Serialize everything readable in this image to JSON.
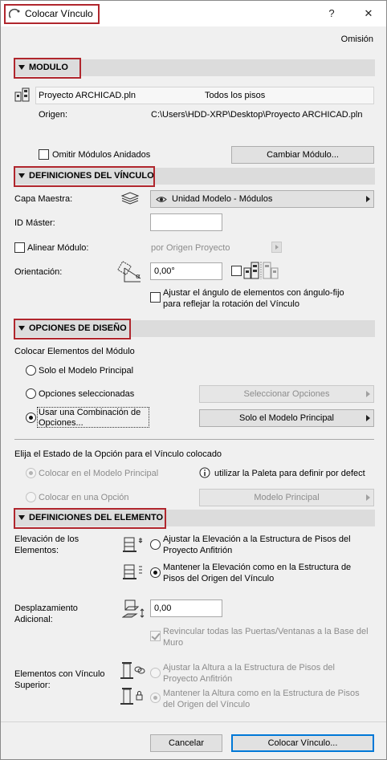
{
  "window": {
    "title": "Colocar Vínculo",
    "help": "?",
    "close": "✕",
    "defaults_label": "Omisión"
  },
  "modulo": {
    "header": "MODULO",
    "project_name": "Proyecto ARCHICAD.pln",
    "stories": "Todos los pisos",
    "origin_label": "Origen:",
    "origin_path": "C:\\Users\\HDD-XRP\\Desktop\\Proyecto ARCHICAD.pln",
    "skip_nested_label": "Omitir Módulos Anidados",
    "change_button": "Cambiar Módulo..."
  },
  "link_settings": {
    "header": "DEFINICIONES DEL VÍNCULO",
    "master_layer_label": "Capa Maestra:",
    "master_layer_value": "Unidad Modelo - Módulos",
    "master_id_label": "ID Máster:",
    "master_id_value": "",
    "align_label": "Alinear Módulo:",
    "align_value": "por Origen Proyecto",
    "orientation_label": "Orientación:",
    "orientation_value": "0,00°",
    "fixed_angle_label_1": "Ajustar el ángulo de elementos con ángulo-fijo",
    "fixed_angle_label_2": "para reflejar la rotación del Vínculo"
  },
  "design_options": {
    "header": "OPCIONES DE DISEÑO",
    "place_elements_label": "Colocar Elementos del Módulo",
    "radio_main_only": "Solo el Modelo Principal",
    "radio_selected": "Opciones seleccionadas",
    "radio_combination_1": "Usar una Combinación de",
    "radio_combination_2": "Opciones...",
    "select_options_button": "Seleccionar Opciones",
    "combination_value": "Solo el Modelo Principal",
    "choose_state_label": "Elija el Estado de la Opción para el Vínculo colocado",
    "place_main_model": "Colocar en el Modelo Principal",
    "info_text": "utilizar la Paleta para definir por defect",
    "place_in_option": "Colocar en una Opción",
    "option_value": "Modelo Principal"
  },
  "element_settings": {
    "header": "DEFINICIONES DEL ELEMENTO",
    "elevation_label_1": "Elevación de los",
    "elevation_label_2": "Elementos:",
    "elev_adjust_1": "Ajustar la Elevación a la Estructura de Pisos del",
    "elev_adjust_2": "Proyecto Anfitrión",
    "elev_keep_1": "Mantener la Elevación como en la Estructura de",
    "elev_keep_2": "Pisos del Origen del Vínculo",
    "offset_label_1": "Desplazamiento",
    "offset_label_2": "Adicional:",
    "offset_value": "0,00",
    "relink_1": "Revincular todas las Puertas/Ventanas a la Base del",
    "relink_2": "Muro",
    "top_linked_label_1": "Elementos con Vínculo",
    "top_linked_label_2": "Superior:",
    "height_adjust_1": "Ajustar la Altura a la Estructura de Pisos del",
    "height_adjust_2": "Proyecto Anfitrión",
    "height_keep_1": "Mantener la Altura como en la Estructura de Pisos",
    "height_keep_2": "del Origen del Vínculo"
  },
  "footer": {
    "cancel": "Cancelar",
    "place": "Colocar Vínculo..."
  },
  "colors": {
    "highlight_box": "#b0262d",
    "primary_border": "#0078d7"
  }
}
